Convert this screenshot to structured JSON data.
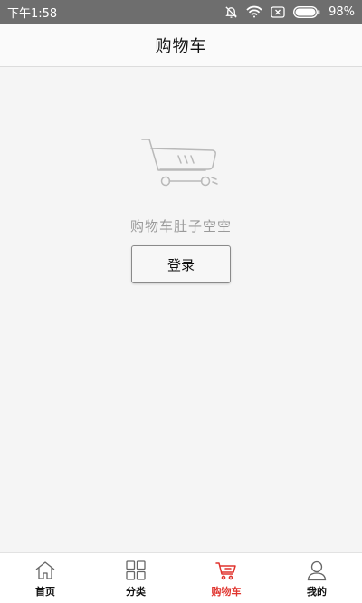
{
  "status_bar": {
    "time": "下午1:58",
    "battery": "98%"
  },
  "header": {
    "title": "购物车"
  },
  "empty_state": {
    "message": "购物车肚子空空",
    "login_label": "登录"
  },
  "tabbar": {
    "active_color": "#e0342e",
    "items": [
      {
        "label": "首页",
        "icon": "home-icon"
      },
      {
        "label": "分类",
        "icon": "grid-icon"
      },
      {
        "label": "购物车",
        "icon": "cart-icon",
        "active": true
      },
      {
        "label": "我的",
        "icon": "user-icon"
      }
    ]
  }
}
